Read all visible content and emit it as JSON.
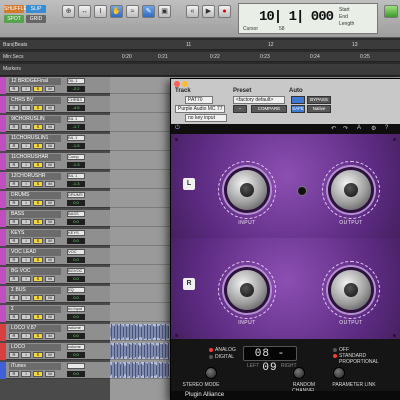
{
  "transport": {
    "modes": [
      "SHUFFLE",
      "SLIP",
      "SPOT",
      "GRID"
    ],
    "counter_main": "10| 1| 000",
    "cursor_label": "Cursor",
    "cursor_value": "58",
    "start_label": "Start",
    "end_label": "End",
    "length_label": "Length",
    "play": "▶",
    "stop": "■",
    "rec": "●"
  },
  "rulers": [
    {
      "label": "Bars|Beats",
      "ticks": [
        "11",
        "12",
        "13"
      ]
    },
    {
      "label": "Min:Secs",
      "ticks": [
        "0:20",
        "0:21",
        "0:22",
        "0:23",
        "0:24",
        "0:25"
      ]
    },
    {
      "label": "Markers",
      "ticks": []
    }
  ],
  "tracks": [
    {
      "name": "12 BRIDGEFinal",
      "fx": "OIL 1",
      "fx2": "",
      "db": "-2.2",
      "color": "#c050c0"
    },
    {
      "name": "CHRS BV",
      "fx": "CHRBS",
      "fx2": "",
      "db": "-4.5",
      "color": "#c050c0"
    },
    {
      "name": "9ICHORUSLIN",
      "fx": "BIL 1",
      "fx2": "",
      "db": "-1.7",
      "color": "#c050c0"
    },
    {
      "name": "11CHORUSLIN1",
      "fx": "BIL 1",
      "fx2": "",
      "db": "-1.5",
      "color": "#c050c0"
    },
    {
      "name": "11CHORUSHAR",
      "fx": "Comp",
      "fx2": "",
      "db": "-1.3",
      "color": "#c050c0"
    },
    {
      "name": "12CHORUSHR",
      "fx": "BIL 1",
      "fx2": "",
      "db": "-1.3",
      "color": "#c050c0"
    },
    {
      "name": "DRUMS",
      "fx": "DRUMS",
      "fx2": "",
      "db": "0.0",
      "color": "#c050c0"
    },
    {
      "name": "BASS",
      "fx": "BASS",
      "fx2": "",
      "db": "0.0",
      "color": "#c050c0"
    },
    {
      "name": "KEYS",
      "fx": "KEYS",
      "fx2": "",
      "db": "0.0",
      "color": "#c050c0"
    },
    {
      "name": "VOC LEAD",
      "fx": "VOC",
      "fx2": "",
      "db": "0.0",
      "color": "#c050c0"
    },
    {
      "name": "BG VOC",
      "fx": "BGVOC",
      "fx2": "",
      "db": "0.0",
      "color": "#c050c0"
    },
    {
      "name": "Σ BUS",
      "fx": "EQ",
      "fx2": "",
      "db": "0.0",
      "color": "#c050c0"
    },
    {
      "name": "Σ",
      "fx": "no input",
      "fx2": "",
      "db": "0.0",
      "color": "#c050c0"
    },
    {
      "name": "LOCO V.87",
      "fx": "volume",
      "fx2": "",
      "db": "0.0",
      "color": "#d84040"
    },
    {
      "name": "LOCO",
      "fx": "volume",
      "fx2": "",
      "db": "0.0",
      "color": "#d84040"
    },
    {
      "name": "iTunes",
      "fx": "",
      "fx2": "",
      "db": "0.0",
      "color": "#4060d8"
    }
  ],
  "plugin": {
    "track_label": "Track",
    "preset_label": "Preset",
    "auto_label": "Auto",
    "track_name": "PAT70",
    "preset_name": "<factory default>",
    "insert_name": "Purple Audio MC 77",
    "compare": "COMPARE",
    "bypass": "BYPASS",
    "safe": "SAFE",
    "native": "Native",
    "no_key": "no key input",
    "top_channel": "L",
    "bottom_channel": "R",
    "input_label": "INPUT",
    "output_label": "OUTPUT",
    "display": "08 - 09",
    "analog": "ANALOG",
    "digital": "DIGITAL",
    "stereo_mode": "STEREO MODE",
    "left": "LEFT",
    "right": "RIGHT",
    "random_channel": "RANDOM CHANNEL",
    "off": "OFF",
    "standard": "STANDARD",
    "proportional": "PROPORTIONAL",
    "parameter_link": "PARAMETER LINK",
    "brand": "Plugin Alliance"
  }
}
